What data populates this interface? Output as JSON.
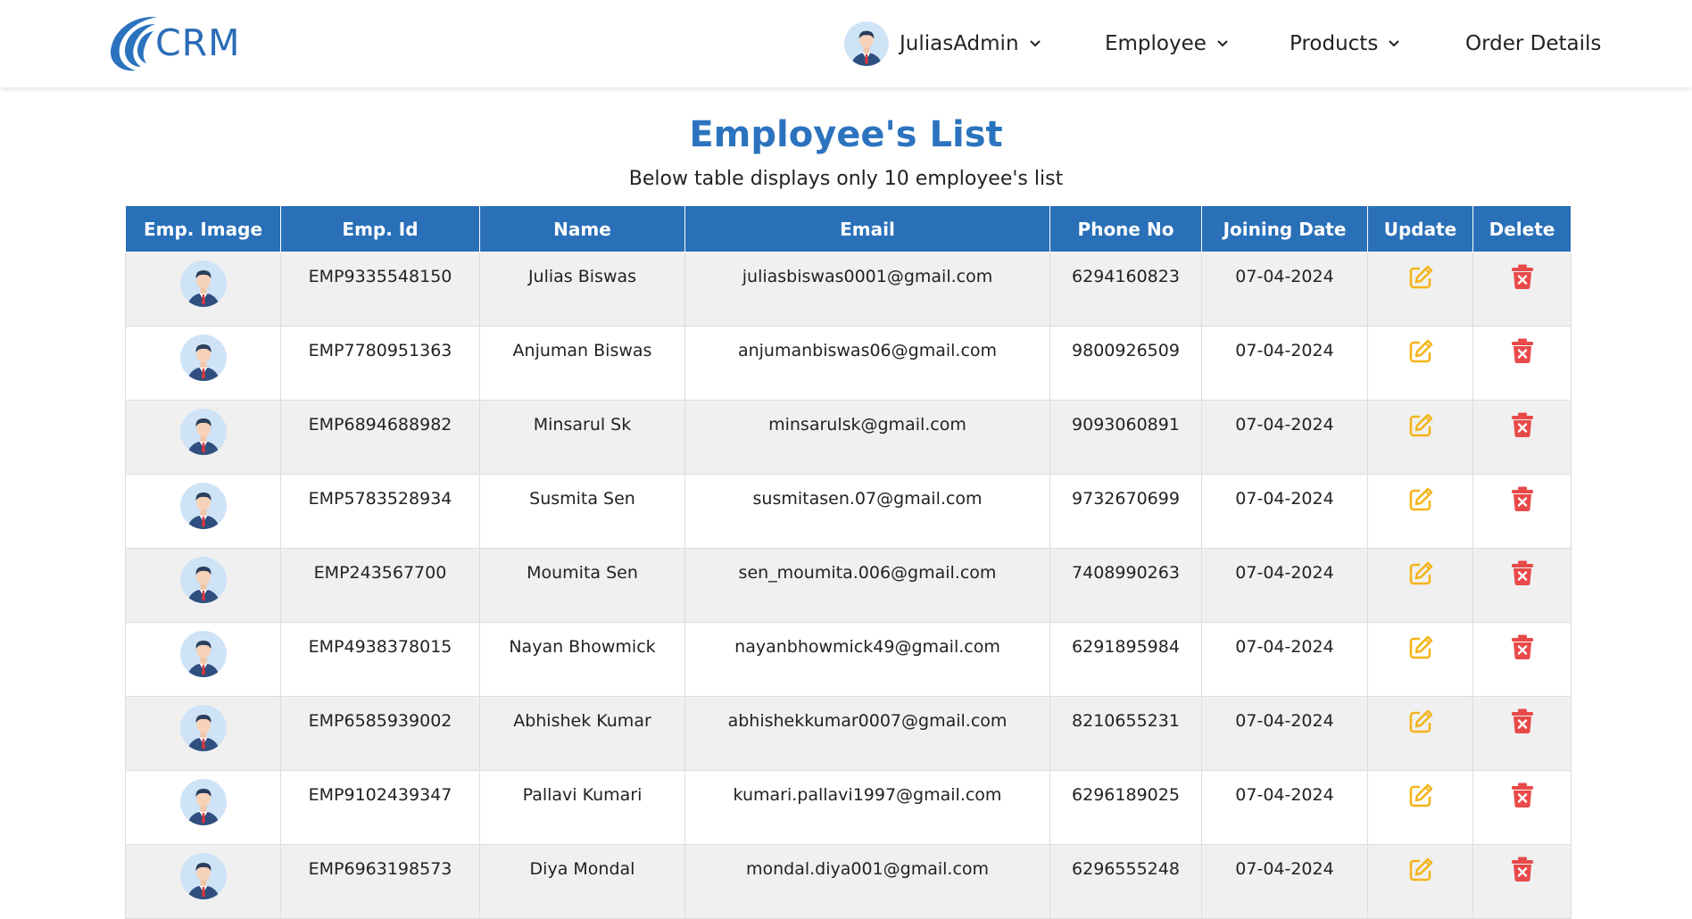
{
  "brand": {
    "logo_text": "CRM"
  },
  "nav": {
    "user": "JuliasAdmin",
    "employee": "Employee",
    "products": "Products",
    "order_details": "Order Details"
  },
  "page": {
    "title": "Employee's List",
    "subtitle": "Below table displays only 10 employee's list"
  },
  "table": {
    "headers": [
      "Emp. Image",
      "Emp. Id",
      "Name",
      "Email",
      "Phone No",
      "Joining Date",
      "Update",
      "Delete"
    ],
    "rows": [
      {
        "id": "EMP9335548150",
        "name": "Julias Biswas",
        "email": "juliasbiswas0001@gmail.com",
        "phone": "6294160823",
        "date": "07-04-2024"
      },
      {
        "id": "EMP7780951363",
        "name": "Anjuman Biswas",
        "email": "anjumanbiswas06@gmail.com",
        "phone": "9800926509",
        "date": "07-04-2024"
      },
      {
        "id": "EMP6894688982",
        "name": "Minsarul Sk",
        "email": "minsarulsk@gmail.com",
        "phone": "9093060891",
        "date": "07-04-2024"
      },
      {
        "id": "EMP5783528934",
        "name": "Susmita Sen",
        "email": "susmitasen.07@gmail.com",
        "phone": "9732670699",
        "date": "07-04-2024"
      },
      {
        "id": "EMP243567700",
        "name": "Moumita Sen",
        "email": "sen_moumita.006@gmail.com",
        "phone": "7408990263",
        "date": "07-04-2024"
      },
      {
        "id": "EMP4938378015",
        "name": "Nayan Bhowmick",
        "email": "nayanbhowmick49@gmail.com",
        "phone": "6291895984",
        "date": "07-04-2024"
      },
      {
        "id": "EMP6585939002",
        "name": "Abhishek Kumar",
        "email": "abhishekkumar0007@gmail.com",
        "phone": "8210655231",
        "date": "07-04-2024"
      },
      {
        "id": "EMP9102439347",
        "name": "Pallavi Kumari",
        "email": "kumari.pallavi1997@gmail.com",
        "phone": "6296189025",
        "date": "07-04-2024"
      },
      {
        "id": "EMP6963198573",
        "name": "Diya Mondal",
        "email": "mondal.diya001@gmail.com",
        "phone": "6296555248",
        "date": "07-04-2024"
      }
    ]
  },
  "icons": {
    "avatar": "employee-avatar-icon",
    "update": "edit-icon",
    "delete": "trash-icon",
    "dropdown": "chevron-down-icon"
  },
  "colors": {
    "brand_blue": "#2b73be",
    "header_blue": "#2a70b8",
    "edit_yellow": "#f5b41b",
    "delete_red": "#e84a4a",
    "row_alt": "#f0f0f0"
  }
}
